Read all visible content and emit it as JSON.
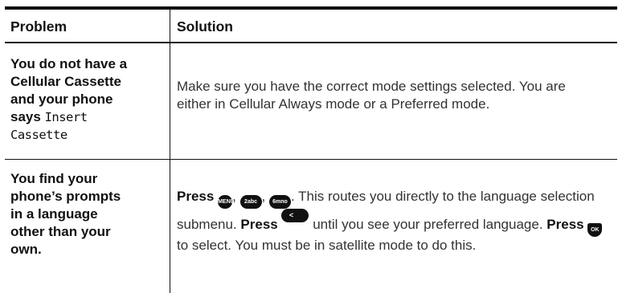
{
  "header": {
    "problem": "Problem",
    "solution": "Solution"
  },
  "rows": [
    {
      "problem_lines": [
        "You do not have a",
        "Cellular Cassette",
        "and your phone"
      ],
      "problem_says": "says",
      "problem_screen_1": "Insert",
      "problem_screen_2": "Cassette",
      "solution": "Make sure you have the correct mode settings selected. You are either in Cellular Always mode or a Preferred mode."
    },
    {
      "problem_lines": [
        "You find your",
        "phone’s prompts",
        "in a language",
        "other than your",
        "own."
      ],
      "solution": {
        "press": "Press",
        "sep_1": ",",
        "sep_2": ",",
        "text_1": ". This routes you directly to the language selection submenu.",
        "text_2": "until you see your preferred language.",
        "text_3": "to select. You must be in satellite mode to do this."
      },
      "keys": {
        "menu": "MENU",
        "two": "2abc",
        "six": "6mno",
        "nav": "< >",
        "ok": "OK"
      }
    }
  ]
}
